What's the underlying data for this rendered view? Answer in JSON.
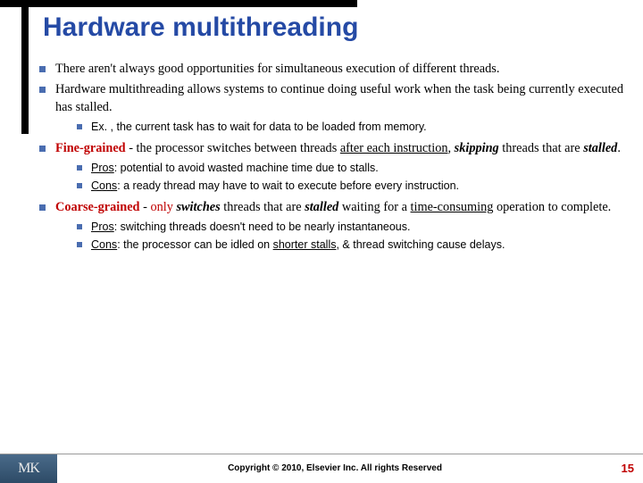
{
  "title": "Hardware multithreading",
  "b1": "There aren't always good opportunities for simultaneous execution of different threads.",
  "b2": "Hardware multithreading allows systems to continue doing useful work when the task being currently executed has stalled.",
  "b2s1": "Ex. , the current task has to wait for data to be loaded from memory.",
  "b3_a": "Fine-grained",
  "b3_b": " - the processor switches between threads ",
  "b3_c": "after each instruction",
  "b3_d": ", ",
  "b3_e": "skipping",
  "b3_f": " threads that are ",
  "b3_g": "stalled",
  "b3_h": ".",
  "b3s1_a": "Pros",
  "b3s1_b": ": potential to avoid wasted machine time due to stalls.",
  "b3s2_a": "Cons",
  "b3s2_b": ": a ready thread may have to wait to execute before every instruction.",
  "b4_a": "Coarse-grained",
  "b4_b": " - ",
  "b4_c": "only",
  "b4_d": " ",
  "b4_e": "switches",
  "b4_f": " threads that are ",
  "b4_g": "stalled",
  "b4_h": " waiting for a ",
  "b4_i": "time-consuming",
  "b4_j": " operation to complete.",
  "b4s1_a": "Pros",
  "b4s1_b": ": switching threads doesn't need to be nearly instantaneous.",
  "b4s2_a": "Cons",
  "b4s2_b": ": the processor can be idled on ",
  "b4s2_c": "shorter stalls",
  "b4s2_d": ", & thread switching cause delays.",
  "logo": "MK",
  "copyright": "Copyright © 2010, Elsevier Inc. All rights Reserved",
  "page": "15"
}
